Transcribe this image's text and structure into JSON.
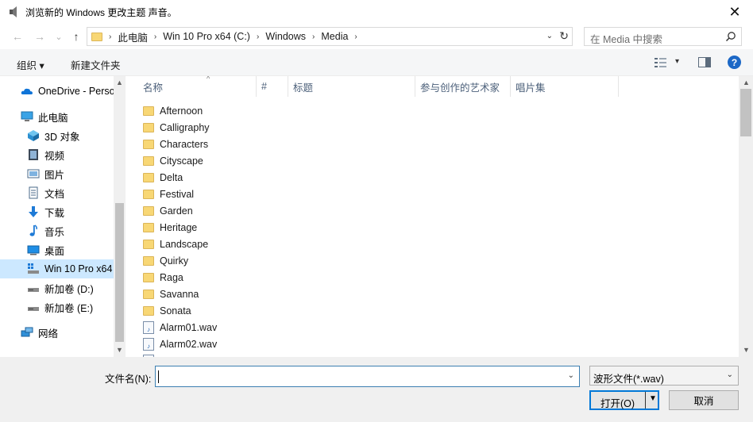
{
  "window": {
    "title": "浏览新的 Windows 更改主题 声音。",
    "close_glyph": "✕"
  },
  "navigation": {
    "back_glyph": "←",
    "forward_glyph": "→",
    "recent_glyph": "⌄",
    "up_glyph": "↑"
  },
  "address": {
    "crumbs": [
      "此电脑",
      "Win 10 Pro x64 (C:)",
      "Windows",
      "Media"
    ],
    "separator": "›",
    "dropdown_glyph": "⌄",
    "refresh_glyph": "↻"
  },
  "search": {
    "placeholder": "在 Media 中搜索"
  },
  "toolbar": {
    "organize_label": "组织 ▾",
    "new_folder_label": "新建文件夹",
    "view_dropdown_glyph": "▾",
    "help_glyph": "?"
  },
  "nav_pane": {
    "items": [
      {
        "label": "OneDrive - Perso",
        "icon": "cloud-icon"
      },
      {
        "label": "此电脑",
        "icon": "computer-icon"
      },
      {
        "label": "3D 对象",
        "icon": "cube-3d-icon"
      },
      {
        "label": "视频",
        "icon": "video-icon"
      },
      {
        "label": "图片",
        "icon": "picture-icon"
      },
      {
        "label": "文档",
        "icon": "document-icon"
      },
      {
        "label": "下载",
        "icon": "download-icon"
      },
      {
        "label": "音乐",
        "icon": "music-icon"
      },
      {
        "label": "桌面",
        "icon": "desktop-icon"
      },
      {
        "label": "Win 10 Pro x64",
        "icon": "drive-c-icon"
      },
      {
        "label": "新加卷 (D:)",
        "icon": "drive-icon"
      },
      {
        "label": "新加卷 (E:)",
        "icon": "drive-icon"
      },
      {
        "label": "网络",
        "icon": "network-icon"
      }
    ],
    "selected_index": 9,
    "scroll_up_glyph": "▲",
    "scroll_down_glyph": "▼"
  },
  "file_list": {
    "columns": [
      "名称",
      "#",
      "标题",
      "参与创作的艺术家",
      "唱片集"
    ],
    "sort_glyph": "^",
    "folders": [
      "Afternoon",
      "Calligraphy",
      "Characters",
      "Cityscape",
      "Delta",
      "Festival",
      "Garden",
      "Heritage",
      "Landscape",
      "Quirky",
      "Raga",
      "Savanna",
      "Sonata"
    ],
    "files": [
      "Alarm01.wav",
      "Alarm02.wav"
    ],
    "scroll_up_glyph": "▲",
    "scroll_down_glyph": "▼"
  },
  "bottom": {
    "filename_label": "文件名(N):",
    "filename_value": "",
    "filename_dropdown_glyph": "⌄",
    "filter_value": "波形文件(*.wav)",
    "filter_dropdown_glyph": "⌄",
    "open_label": "打开(O)",
    "open_split_glyph": "▼",
    "cancel_label": "取消"
  },
  "colors": {
    "accent": "#0078d7",
    "selection": "#cce8ff",
    "folder": "#f8d775",
    "help": "#1c68c6"
  }
}
